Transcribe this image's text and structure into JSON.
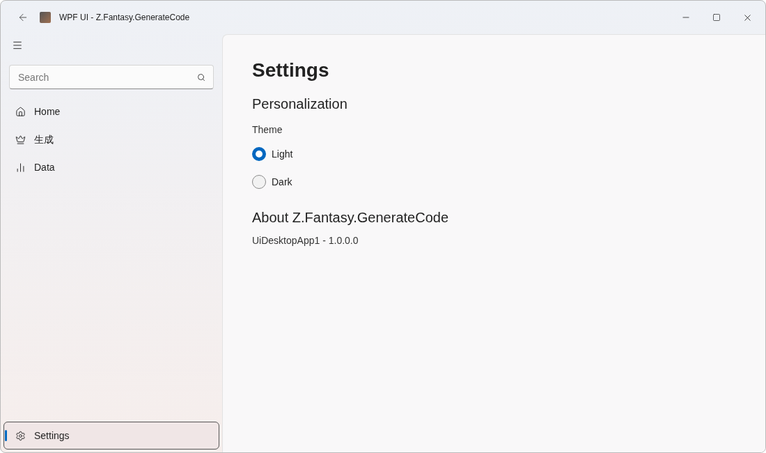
{
  "window": {
    "title": "WPF UI - Z.Fantasy.GenerateCode"
  },
  "search": {
    "placeholder": "Search"
  },
  "nav": [
    {
      "label": "Home",
      "selected": false
    },
    {
      "label": "生成",
      "selected": false
    },
    {
      "label": "Data",
      "selected": false
    }
  ],
  "footer_nav": [
    {
      "label": "Settings",
      "selected": true
    }
  ],
  "page": {
    "title": "Settings",
    "personalization": {
      "heading": "Personalization",
      "label": "Theme",
      "options": [
        {
          "label": "Light",
          "selected": true
        },
        {
          "label": "Dark",
          "selected": false
        }
      ]
    },
    "about": {
      "heading": "About Z.Fantasy.GenerateCode",
      "version": "UiDesktopApp1 - 1.0.0.0"
    }
  }
}
